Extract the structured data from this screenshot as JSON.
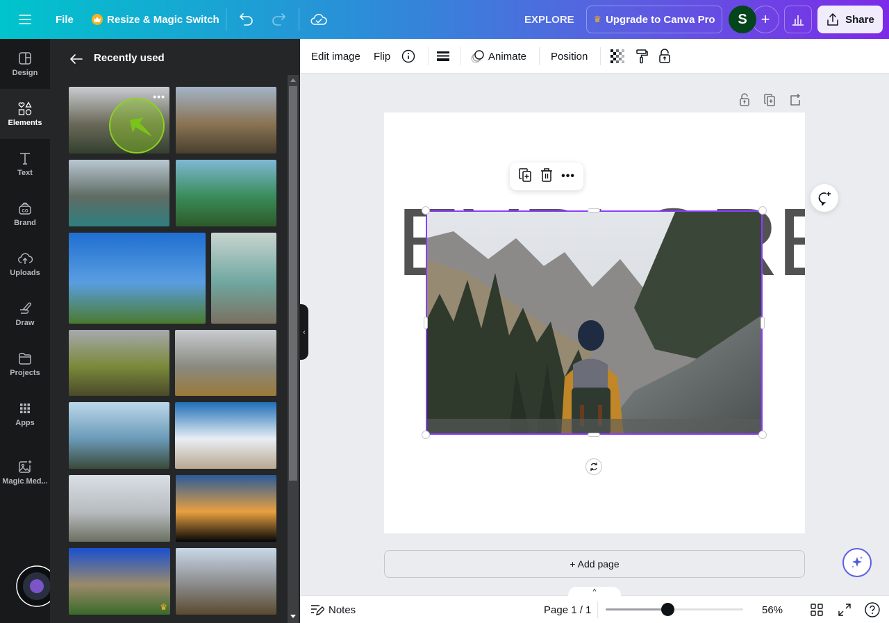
{
  "topbar": {
    "menu_icon": "hamburger-icon",
    "file_label": "File",
    "resize_label": "Resize & Magic Switch",
    "undo_icon": "undo-icon",
    "redo_icon": "redo-icon",
    "cloud_icon": "cloud-check-icon",
    "doc_title": "EXPLORE",
    "upgrade_label": "Upgrade to Canva Pro",
    "avatar_initial": "S",
    "share_label": "Share",
    "brand_color": "#7d2ae8",
    "accent_teal": "#00c4cc"
  },
  "rail": {
    "items": [
      {
        "label": "Design",
        "icon": "layout-icon"
      },
      {
        "label": "Elements",
        "icon": "shapes-icon",
        "active": true
      },
      {
        "label": "Text",
        "icon": "text-icon"
      },
      {
        "label": "Brand",
        "icon": "brand-icon"
      },
      {
        "label": "Uploads",
        "icon": "upload-cloud-icon"
      },
      {
        "label": "Draw",
        "icon": "draw-icon"
      },
      {
        "label": "Projects",
        "icon": "folder-icon"
      },
      {
        "label": "Apps",
        "icon": "apps-grid-icon"
      },
      {
        "label": "Magic Med...",
        "icon": "magic-media-icon"
      }
    ]
  },
  "panel": {
    "title": "Recently used",
    "thumbnails": [
      {
        "desc": "Hiker with yellow jacket in pine valley",
        "colors": [
          "#c9ccd0",
          "#6b6a5a",
          "#34402e"
        ],
        "has_overlay": true
      },
      {
        "desc": "Hiker with poles facing snowy mountains",
        "colors": [
          "#a3b4c8",
          "#8a7454",
          "#4a3f2e"
        ]
      },
      {
        "desc": "Person sitting at turquoise alpine lake",
        "colors": [
          "#b9c7d2",
          "#5f6c63",
          "#2f7f80"
        ]
      },
      {
        "desc": "Person facing volcano over green hills",
        "colors": [
          "#7fb8d4",
          "#3a8c5a",
          "#2d5a2a"
        ]
      },
      {
        "desc": "Hiker with orange backpack on peak, blue sky",
        "colors": [
          "#1f6fd2",
          "#5a9ee0",
          "#4a7a2e"
        ]
      },
      {
        "desc": "Two people overlooking river canyon",
        "colors": [
          "#c9d4cf",
          "#6fa7a0",
          "#7a7060"
        ]
      },
      {
        "desc": "Couple sitting on wall facing green mountains",
        "colors": [
          "#a6a9ae",
          "#7a8a3a",
          "#4a4a2a"
        ]
      },
      {
        "desc": "Woman in purple jacket facing foggy valley",
        "colors": [
          "#c8ccd0",
          "#8a8a80",
          "#9a7a3a"
        ]
      },
      {
        "desc": "Person with binoculars above sea of clouds",
        "colors": [
          "#bcd8ea",
          "#6a9ab8",
          "#3a4a3a"
        ]
      },
      {
        "desc": "Woman walking on dirt road toward snowy peaks",
        "colors": [
          "#1f6fb8",
          "#e8eef4",
          "#b8a890"
        ]
      },
      {
        "desc": "Person on rocky peak above clouds",
        "colors": [
          "#d8dfe5",
          "#b8bcc0",
          "#6a7060"
        ]
      },
      {
        "desc": "Silhouettes of people at sunset",
        "colors": [
          "#2a5a9a",
          "#e8a040",
          "#050608"
        ]
      },
      {
        "desc": "Group of hikers on rocky trail",
        "colors": [
          "#1a4fd0",
          "#9a8a6a",
          "#3a6a2a"
        ],
        "premium": true
      },
      {
        "desc": "Hiker with yellow backpack facing snowy mountains",
        "colors": [
          "#c8d8e8",
          "#8a8a8a",
          "#5a4a30"
        ]
      }
    ],
    "more_icon": "more-horizontal-icon",
    "premium_icon": "crown-icon"
  },
  "context_toolbar": {
    "edit_image": "Edit image",
    "flip": "Flip",
    "info_icon": "info-icon",
    "border_icon": "border-style-icon",
    "animate": "Animate",
    "position": "Position",
    "transparency_icon": "transparency-icon",
    "paint_icon": "copy-style-icon",
    "lock_icon": "lock-icon"
  },
  "canvas": {
    "page_actions": [
      "unlock-icon",
      "duplicate-page-icon",
      "add-page-icon"
    ],
    "headline": "EXPLORE",
    "photo_desc": "Hiker in yellow jacket and beanie facing mountain valley with pines",
    "selection_color": "#8b3dff",
    "float_menu": [
      "duplicate-icon",
      "trash-icon",
      "more-icon"
    ],
    "add_page_label": "+ Add page"
  },
  "bottombar": {
    "notes_label": "Notes",
    "page_indicator": "Page 1 / 1",
    "zoom_value": 56,
    "zoom_label": "56%",
    "zoom_slider_fraction": 0.45
  }
}
